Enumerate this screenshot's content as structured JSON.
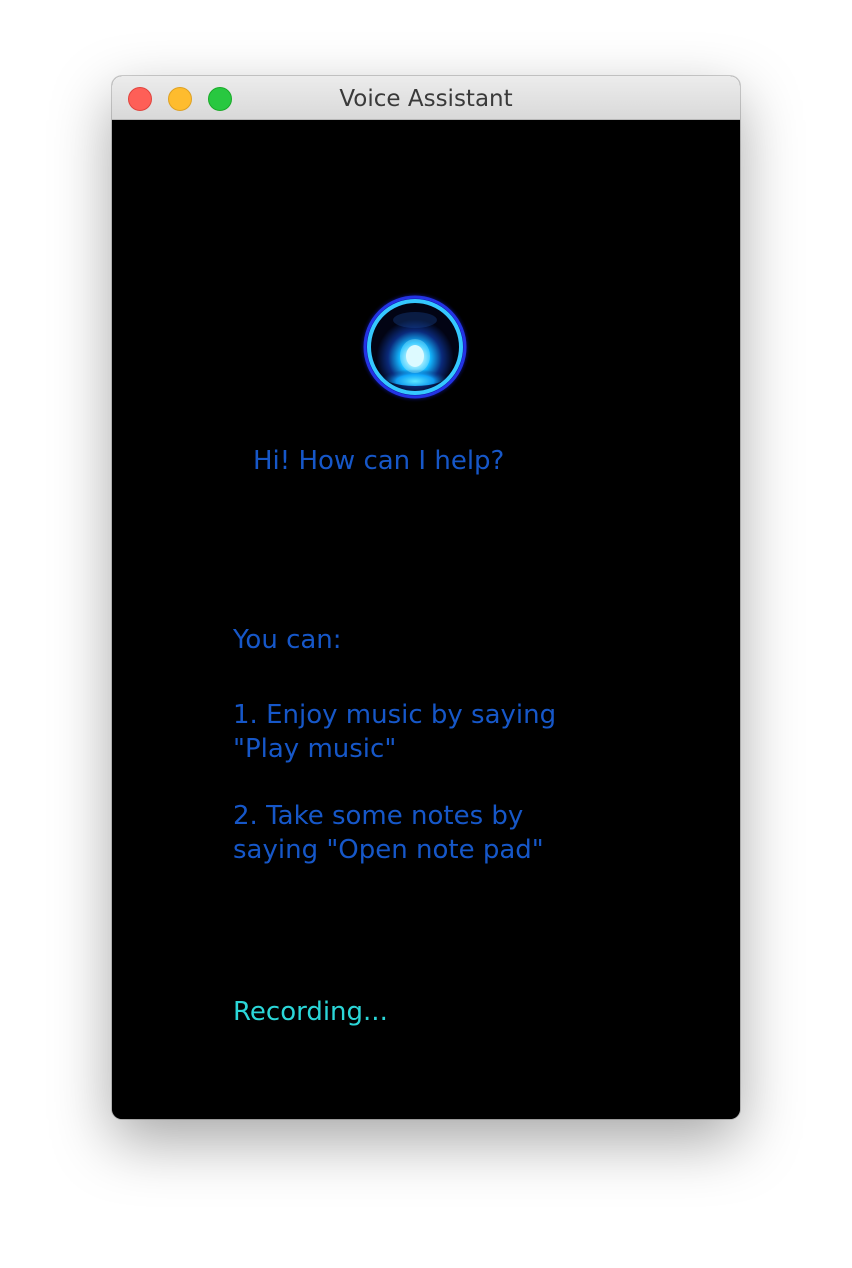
{
  "window": {
    "title": "Voice Assistant"
  },
  "orb": {
    "icon": "voice-orb-icon",
    "color_core": "#ffffff",
    "color_glow": "#00aaff",
    "color_ring": "#1a3cff"
  },
  "main": {
    "greeting": "Hi! How can I help?",
    "intro": "You can:",
    "suggestions": [
      {
        "line1": "1. Enjoy music by saying",
        "line2": "\"Play music\""
      },
      {
        "line1": "2. Take some notes by",
        "line2": "saying \"Open note pad\""
      }
    ],
    "status": "Recording..."
  },
  "colors": {
    "text": "#1657c8",
    "status": "#2bd6d8",
    "background": "#000000"
  }
}
